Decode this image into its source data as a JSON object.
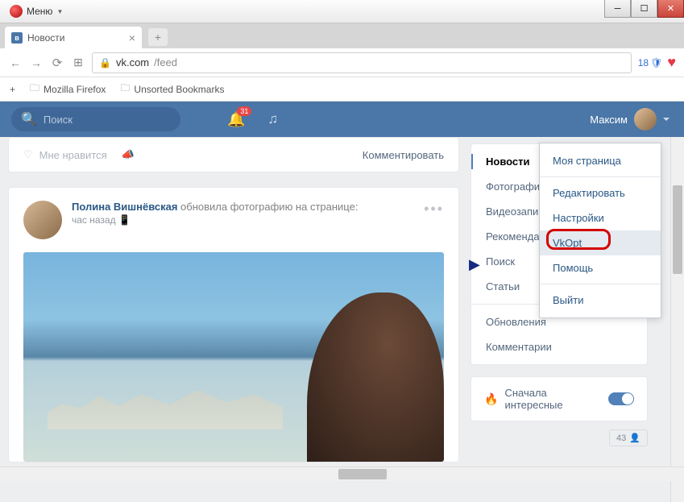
{
  "window": {
    "menu_label": "Меню"
  },
  "tab": {
    "title": "Новости"
  },
  "address": {
    "domain": "vk.com",
    "path": "/feed",
    "shield_count": "18"
  },
  "bookmarks": {
    "add": "+",
    "items": [
      "Mozilla Firefox",
      "Unsorted Bookmarks"
    ]
  },
  "vk_header": {
    "search_placeholder": "Поиск",
    "notif_count": "31",
    "username": "Максим"
  },
  "feed": {
    "like_label": "Мне нравится",
    "comment_label": "Комментировать",
    "post": {
      "author": "Полина Вишнёвская",
      "action_text": "обновила фотографию на странице:",
      "time": "час назад"
    }
  },
  "sidebar": {
    "items": [
      "Новости",
      "Фотографии",
      "Видеозаписи",
      "Рекомендации",
      "Поиск",
      "Статьи"
    ],
    "extra": [
      "Обновления",
      "Комментарии"
    ],
    "sort_label": "Сначала интересные",
    "count": "43"
  },
  "dropdown": {
    "items": [
      "Моя страница",
      "Редактировать",
      "Настройки",
      "VkOpt",
      "Помощь"
    ],
    "logout": "Выйти"
  }
}
